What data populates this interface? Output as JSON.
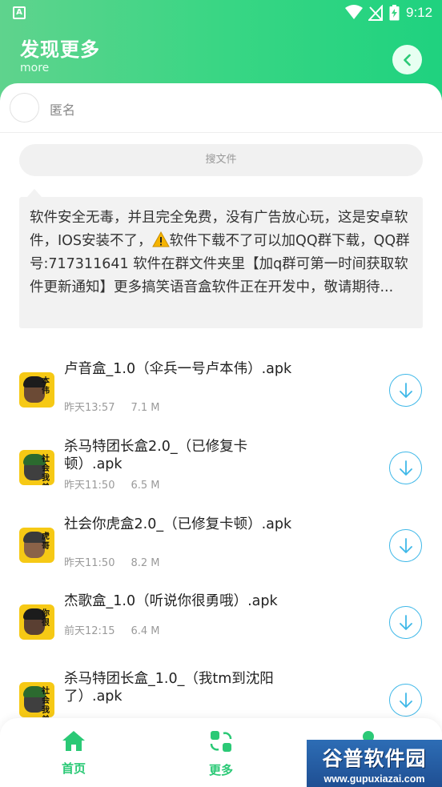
{
  "status_bar": {
    "app_indicator": "A",
    "time": "9:12"
  },
  "header": {
    "title": "发现更多",
    "subtitle": "more",
    "back_icon": "chevron-left-icon"
  },
  "user": {
    "name": "匿名"
  },
  "search": {
    "placeholder": "搜文件"
  },
  "notice": {
    "text_before": "软件安全无毒，并且完全免费，没有广告放心玩，这是安卓软件，IOS安装不了，",
    "text_after": "软件下载不了可以加QQ群下载，QQ群号:717311641 软件在群文件夹里【加q群可第一时间获取软件更新通知】更多搞笑语音盒软件正在开发中，敬请期待...",
    "warning_icon": "warning-icon"
  },
  "files": [
    {
      "title": "卢音盒_1.0（伞兵一号卢本伟）.apk",
      "time": "昨天13:57",
      "size": "7.1 M",
      "thumb_text": "本伟"
    },
    {
      "title": "杀马特团长盒2.0_（已修复卡顿）.apk",
      "time": "昨天11:50",
      "size": "6.5 M",
      "thumb_text": "社会我弟"
    },
    {
      "title": "社会你虎盒2.0_（已修复卡顿）.apk",
      "time": "昨天11:50",
      "size": "8.2 M",
      "thumb_text": "虎哥"
    },
    {
      "title": "杰歌盒_1.0（听说你很勇哦）.apk",
      "time": "前天12:15",
      "size": "6.4 M",
      "thumb_text": "你很"
    },
    {
      "title": "杀马特团长盒_1.0_（我tm到沈阳了）.apk",
      "time": "",
      "size": "",
      "thumb_text": "社会我弟"
    }
  ],
  "bottom_nav": [
    {
      "label": "首页",
      "icon": "home-icon"
    },
    {
      "label": "更多",
      "icon": "more-icon"
    },
    {
      "label": "",
      "icon": "profile-icon"
    }
  ],
  "watermark": {
    "title": "谷普软件园",
    "url": "www.gupuxiazai.com"
  },
  "colors": {
    "accent": "#2bc976",
    "download": "#3fb8e8",
    "header_start": "#5fd38d",
    "header_end": "#1fd27f"
  }
}
